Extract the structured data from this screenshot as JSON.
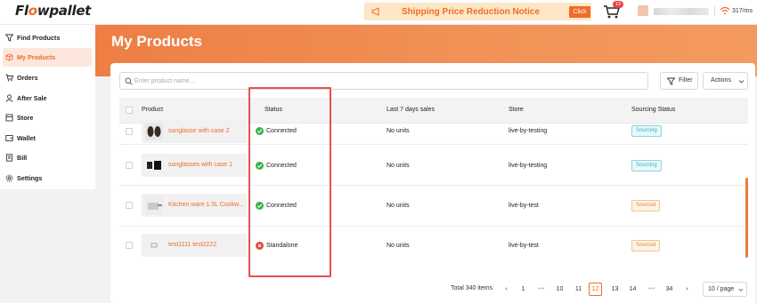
{
  "app": {
    "logo_prefix": "Fl",
    "logo_highlight": "o",
    "logo_suffix": "wpallet"
  },
  "notice": {
    "text": "Shipping Price Reduction Notice",
    "click_label": "Click"
  },
  "cart": {
    "badge": "13"
  },
  "network": {
    "latency": "317/ms"
  },
  "sidebar": {
    "items": [
      {
        "label": "Find Products",
        "icon": "funnel-icon"
      },
      {
        "label": "My Products",
        "icon": "box-icon",
        "active": true
      },
      {
        "label": "Orders",
        "icon": "cart-icon"
      },
      {
        "label": "After Sale",
        "icon": "person-icon"
      },
      {
        "label": "Store",
        "icon": "store-icon"
      },
      {
        "label": "Wallet",
        "icon": "wallet-icon"
      },
      {
        "label": "Bill",
        "icon": "bill-icon"
      },
      {
        "label": "Settings",
        "icon": "gear-icon"
      }
    ]
  },
  "main": {
    "title": "My Products",
    "search": {
      "placeholder": "Enter product name..."
    },
    "filter_label": "Filter",
    "actions_label": "Actions",
    "columns": [
      "Product",
      "Status",
      "Last 7 days sales",
      "Store",
      "Sourcing Status"
    ],
    "rows": [
      {
        "name": "sunglasse with case 2",
        "status": "Connected",
        "status_type": "ok",
        "sales": "No units",
        "store": "live-by-testing",
        "sourcing": "Sourcing"
      },
      {
        "name": "sunglasses with case 1",
        "status": "Connected",
        "status_type": "ok",
        "sales": "No units",
        "store": "live-by-testing",
        "sourcing": "Sourcing"
      },
      {
        "name": "Kitchen ware 1.5L Cookw...",
        "status": "Connected",
        "status_type": "ok",
        "sales": "No units",
        "store": "live-by-test",
        "sourcing": "Sourced"
      },
      {
        "name": "test1111 test2222",
        "status": "Standalone",
        "status_type": "error",
        "sales": "No units",
        "store": "live-by-test",
        "sourcing": "Sourced"
      }
    ]
  },
  "pagination": {
    "total": "Total 340 items",
    "pages": [
      "1",
      "10",
      "11",
      "12",
      "13",
      "14",
      "34"
    ],
    "current": "12",
    "page_size": "10 / page"
  },
  "colors": {
    "accent": "#ef6c2a",
    "connected": "#3ab54a",
    "standalone": "#e0493b",
    "highlight_box": "#e5524f"
  }
}
